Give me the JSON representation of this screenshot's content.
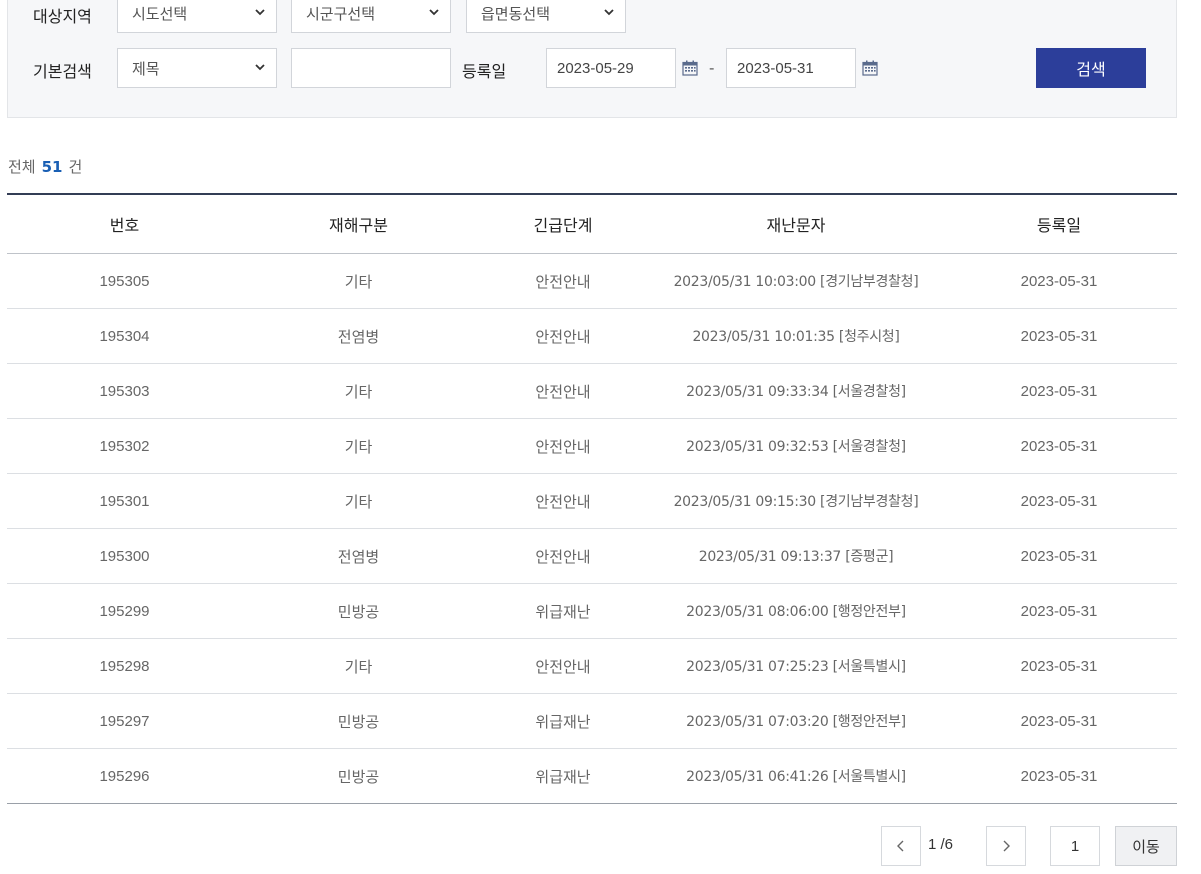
{
  "filters": {
    "region_label": "대상지역",
    "sido_select": "시도선택",
    "sigungu_select": "시군구선택",
    "eupmyeondong_select": "읍면동선택",
    "basic_search_label": "기본검색",
    "search_field_select": "제목",
    "search_keyword": "",
    "reg_date_label": "등록일",
    "date_from": "2023-05-29",
    "date_separator": "-",
    "date_to": "2023-05-31",
    "search_button": "검색"
  },
  "summary": {
    "prefix": "전체",
    "count": "51",
    "suffix": "건"
  },
  "table": {
    "headers": [
      "번호",
      "재해구분",
      "긴급단계",
      "재난문자",
      "등록일"
    ],
    "rows": [
      [
        "195305",
        "기타",
        "안전안내",
        "2023/05/31 10:03:00 [경기남부경찰청]",
        "2023-05-31"
      ],
      [
        "195304",
        "전염병",
        "안전안내",
        "2023/05/31 10:01:35 [청주시청]",
        "2023-05-31"
      ],
      [
        "195303",
        "기타",
        "안전안내",
        "2023/05/31 09:33:34 [서울경찰청]",
        "2023-05-31"
      ],
      [
        "195302",
        "기타",
        "안전안내",
        "2023/05/31 09:32:53 [서울경찰청]",
        "2023-05-31"
      ],
      [
        "195301",
        "기타",
        "안전안내",
        "2023/05/31 09:15:30 [경기남부경찰청]",
        "2023-05-31"
      ],
      [
        "195300",
        "전염병",
        "안전안내",
        "2023/05/31 09:13:37 [증평군]",
        "2023-05-31"
      ],
      [
        "195299",
        "민방공",
        "위급재난",
        "2023/05/31 08:06:00 [행정안전부]",
        "2023-05-31"
      ],
      [
        "195298",
        "기타",
        "안전안내",
        "2023/05/31 07:25:23 [서울특별시]",
        "2023-05-31"
      ],
      [
        "195297",
        "민방공",
        "위급재난",
        "2023/05/31 07:03:20 [행정안전부]",
        "2023-05-31"
      ],
      [
        "195296",
        "민방공",
        "위급재난",
        "2023/05/31 06:41:26 [서울특별시]",
        "2023-05-31"
      ]
    ]
  },
  "pagination": {
    "page_info": "1 /6",
    "page_input": "1",
    "go_button": "이동",
    "prev_icon": "chevron-left-icon",
    "next_icon": "chevron-right-icon"
  },
  "colors": {
    "accent": "#2c3e9a",
    "count_blue": "#1a5fb4",
    "table_top_border": "#333d55"
  }
}
